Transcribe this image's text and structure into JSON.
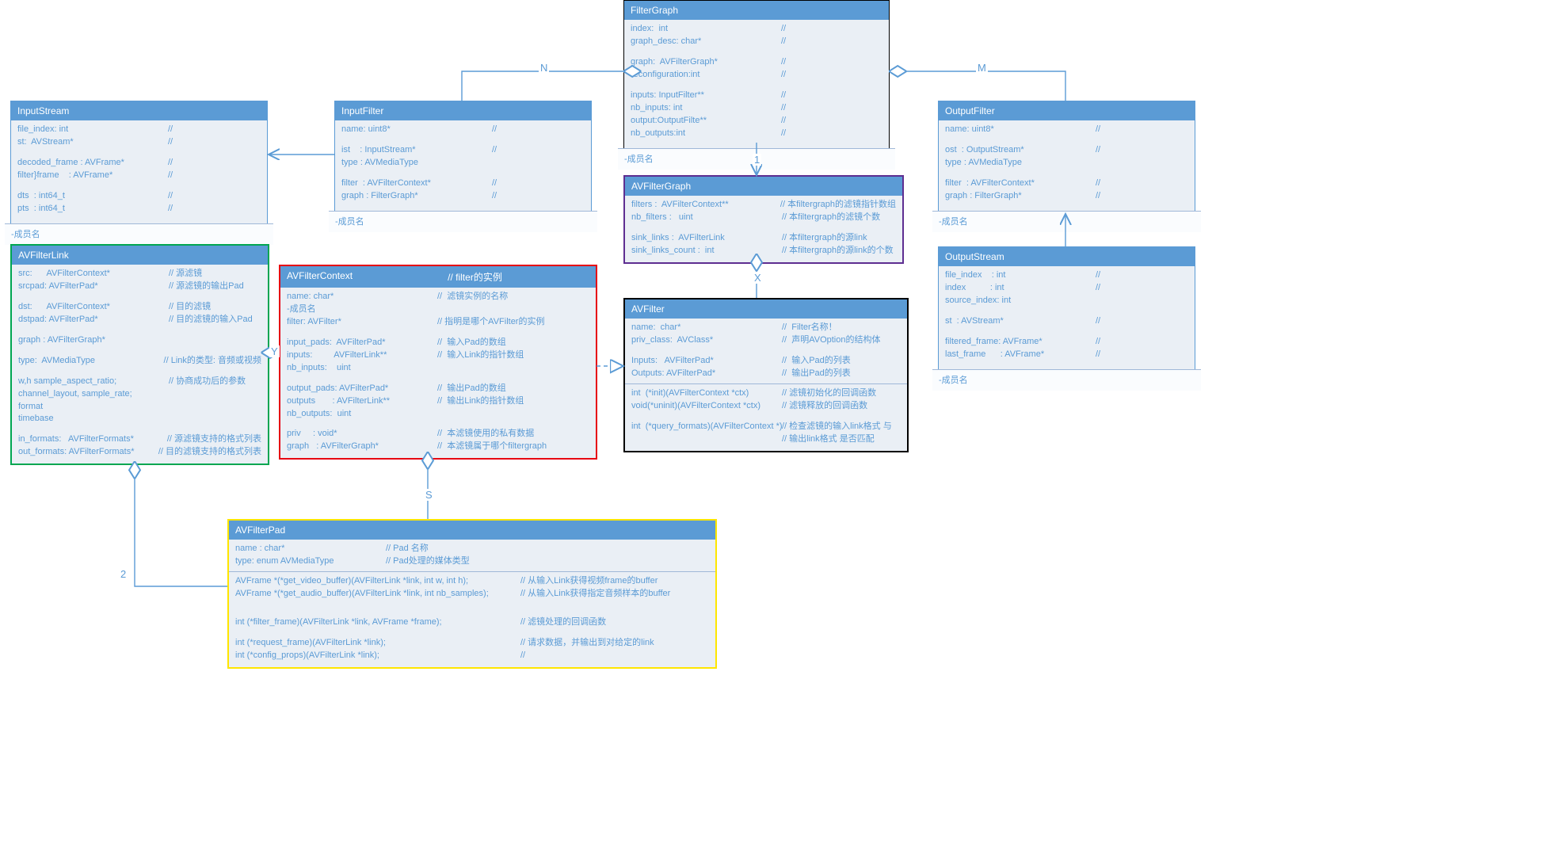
{
  "boxes": {
    "InputStream": {
      "title": "InputStream",
      "footer": "-成员名",
      "fields": [
        {
          "l": "file_index: int",
          "r": "//"
        },
        {
          "l": "st:  AVStream*",
          "r": "//"
        },
        {
          "gap": true
        },
        {
          "l": "decoded_frame : AVFrame*",
          "r": "//"
        },
        {
          "l": "filter}frame    : AVFrame*",
          "r": "//"
        },
        {
          "gap": true
        },
        {
          "l": "dts  : int64_t",
          "r": "//"
        },
        {
          "l": "pts  : int64_t",
          "r": "//"
        }
      ]
    },
    "InputFilter": {
      "title": "InputFilter",
      "footer": "-成员名",
      "fields": [
        {
          "l": "name: uint8*",
          "r": "//"
        },
        {
          "gap": true
        },
        {
          "l": "ist    : InputStream*",
          "r": "//"
        },
        {
          "l": "type : AVMediaType",
          "r": ""
        },
        {
          "gap": true
        },
        {
          "l": "filter  : AVFilterContext*",
          "r": "//"
        },
        {
          "l": "graph : FilterGraph*",
          "r": "//"
        }
      ]
    },
    "FilterGraph": {
      "title": "FilterGraph",
      "footer": "-成员名",
      "fields": [
        {
          "l": "index:  int",
          "r": "//"
        },
        {
          "l": "graph_desc: char*",
          "r": "//"
        },
        {
          "gap": true
        },
        {
          "l": "graph:  AVFilterGraph*",
          "r": "//"
        },
        {
          "l": "reconfiguration:int",
          "r": "//"
        },
        {
          "gap": true
        },
        {
          "l": "inputs: InputFilter**",
          "r": "//"
        },
        {
          "l": "nb_inputs: int",
          "r": "//"
        },
        {
          "l": "output:OutputFilte**",
          "r": "//"
        },
        {
          "l": "nb_outputs:int",
          "r": "//"
        }
      ]
    },
    "OutputFilter": {
      "title": "OutputFilter",
      "footer": "-成员名",
      "fields": [
        {
          "l": "name: uint8*",
          "r": "//"
        },
        {
          "gap": true
        },
        {
          "l": "ost  : OutputStream*",
          "r": "//"
        },
        {
          "l": "type : AVMediaType",
          "r": ""
        },
        {
          "gap": true
        },
        {
          "l": "filter  : AVFilterContext*",
          "r": "//"
        },
        {
          "l": "graph : FilterGraph*",
          "r": "//"
        }
      ]
    },
    "AVFilterLink": {
      "title": "AVFilterLink",
      "fields": [
        {
          "l": "src:      AVFilterContext*",
          "r": "// 源滤镜"
        },
        {
          "l": "srcpad: AVFilterPad*",
          "r": "// 源滤镜的输出Pad"
        },
        {
          "gap": true
        },
        {
          "l": "dst:      AVFilterContext*",
          "r": "// 目的滤镜"
        },
        {
          "l": "dstpad: AVFilterPad*",
          "r": "// 目的滤镜的输入Pad"
        },
        {
          "gap": true
        },
        {
          "l": "graph : AVFilterGraph*",
          "r": ""
        },
        {
          "gap": true
        },
        {
          "l": "type:  AVMediaType",
          "r": "// Link的类型: 音频或视频"
        },
        {
          "gap": true
        },
        {
          "l": "w,h sample_aspect_ratio;",
          "r": "// 协商成功后的参数"
        },
        {
          "l": "channel_layout, sample_rate;",
          "r": ""
        },
        {
          "l": "format",
          "r": ""
        },
        {
          "l": "timebase",
          "r": ""
        },
        {
          "gap": true
        },
        {
          "l": "in_formats:   AVFilterFormats*",
          "r": "// 源滤镜支持的格式列表"
        },
        {
          "l": "out_formats: AVFilterFormats*",
          "r": "// 目的滤镜支持的格式列表"
        }
      ]
    },
    "AVFilterContext": {
      "title": "AVFilterContext",
      "titleComment": "// filter的实例",
      "fields": [
        {
          "l": "name: char*",
          "r": "//  滤镜实例的名称"
        },
        {
          "l": "-成员名",
          "r": ""
        },
        {
          "l": "filter: AVFilter*",
          "r": "// 指明是哪个AVFilter的实例"
        },
        {
          "gap": true
        },
        {
          "l": "input_pads:  AVFilterPad*",
          "r": "//  输入Pad的数组"
        },
        {
          "l": "inputs:         AVFilterLink**",
          "r": "//  输入Link的指针数组"
        },
        {
          "l": "nb_inputs:    uint",
          "r": ""
        },
        {
          "gap": true
        },
        {
          "l": "output_pads: AVFilterPad*",
          "r": "//  输出Pad的数组"
        },
        {
          "l": "outputs       : AVFilterLink**",
          "r": "//  输出Link的指针数组"
        },
        {
          "l": "nb_outputs:  uint",
          "r": ""
        },
        {
          "gap": true
        },
        {
          "l": "priv     : void*",
          "r": "//  本滤镜使用的私有数据"
        },
        {
          "l": "graph   : AVFilterGraph*",
          "r": "//  本滤镜属于哪个filtergraph"
        }
      ]
    },
    "AVFilterGraph": {
      "title": "AVFilterGraph",
      "fields": [
        {
          "l": "filters :  AVFilterContext**",
          "r": "// 本filtergraph的滤镜指针数组"
        },
        {
          "l": "nb_filters :   uint",
          "r": "// 本filtergraph的滤镜个数"
        },
        {
          "gap": true
        },
        {
          "l": "sink_links :  AVFilterLink",
          "r": "// 本filtergraph的源link"
        },
        {
          "l": "sink_links_count :  int",
          "r": "// 本filtergraph的源link的个数"
        }
      ]
    },
    "AVFilter": {
      "title": "AVFilter",
      "fields": [
        {
          "l": "name:  char*",
          "r": "//  Filter名称！"
        },
        {
          "l": "priv_class:  AVClass*",
          "r": "//  声明AVOption的结构体"
        },
        {
          "gap": true
        },
        {
          "l": "Inputs:   AVFilterPad*",
          "r": "//  输入Pad的列表"
        },
        {
          "l": "Outputs: AVFilterPad*",
          "r": "//  输出Pad的列表"
        },
        {
          "divider": true
        },
        {
          "l": "int  (*init)(AVFilterContext *ctx)",
          "r": "// 滤镜初始化的回调函数"
        },
        {
          "l": "void(*uninit)(AVFilterContext *ctx)",
          "r": "// 滤镜释放的回调函数"
        },
        {
          "gap": true
        },
        {
          "l": "int  (*query_formats)(AVFilterContext *)",
          "r": "// 检查滤镜的输入link格式 与"
        },
        {
          "l": "",
          "r": "// 输出link格式 是否匹配"
        }
      ]
    },
    "OutputStream": {
      "title": "OutputStream",
      "footer": "-成员名",
      "fields": [
        {
          "l": "file_index    : int",
          "r": "//"
        },
        {
          "l": "index          : int",
          "r": "//"
        },
        {
          "l": "source_index: int",
          "r": ""
        },
        {
          "gap": true
        },
        {
          "l": "st  : AVStream*",
          "r": "//"
        },
        {
          "gap": true
        },
        {
          "l": "filtered_frame: AVFrame*",
          "r": "//"
        },
        {
          "l": "last_frame      : AVFrame*",
          "r": "//"
        }
      ]
    },
    "AVFilterPad": {
      "title": "AVFilterPad",
      "fields": [
        {
          "l": "name : char*",
          "r": "// Pad 名称"
        },
        {
          "l": "type: enum AVMediaType",
          "r": "// Pad处理的媒体类型"
        },
        {
          "divider": true
        },
        {
          "l": "AVFrame *(*get_video_buffer)(AVFilterLink *link, int w, int h);",
          "r": "// 从输入Link获得视频frame的buffer",
          "wide": true
        },
        {
          "l": "AVFrame *(*get_audio_buffer)(AVFilterLink *link, int nb_samples);",
          "r": "// 从输入Link获得指定音频样本的buffer",
          "wide": true
        },
        {
          "gap": true
        },
        {
          "gap": true
        },
        {
          "l": "int (*filter_frame)(AVFilterLink *link, AVFrame *frame);",
          "r": "// 滤镜处理的回调函数",
          "wide": true
        },
        {
          "gap": true
        },
        {
          "l": "int (*request_frame)(AVFilterLink *link);",
          "r": "// 请求数据，并输出到对给定的link",
          "wide": true
        },
        {
          "l": "int (*config_props)(AVFilterLink *link);",
          "r": "//",
          "wide": true
        }
      ]
    }
  },
  "labels": {
    "N": "N",
    "M": "M",
    "one": "1",
    "X": "X",
    "Y": "Y",
    "S": "S",
    "two": "2"
  }
}
